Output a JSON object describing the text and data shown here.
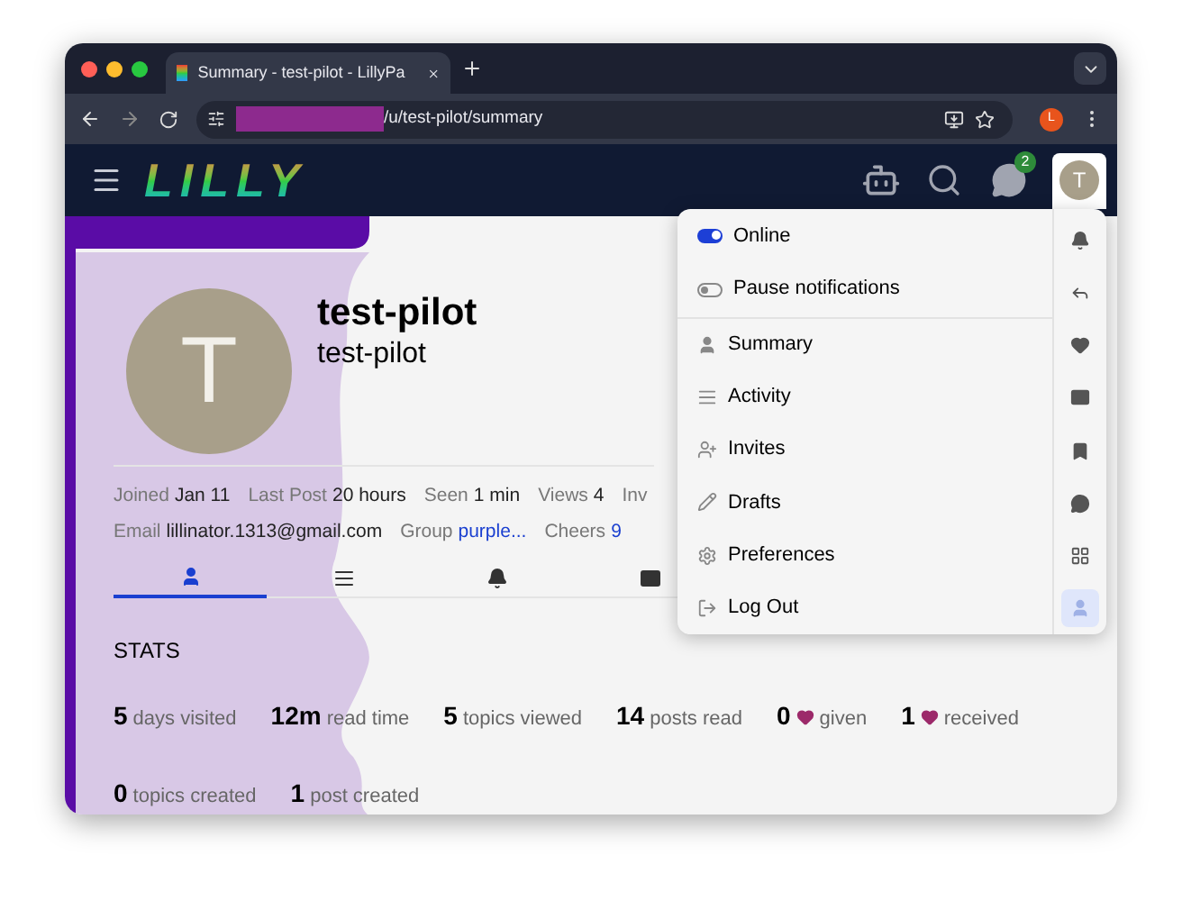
{
  "browser": {
    "tab_title": "Summary - test-pilot - LillyPa",
    "url_path": "/u/test-pilot/summary",
    "profile_initial": "L"
  },
  "header": {
    "logo": "LILLY",
    "chat_badge": "2",
    "avatar_initial": "T"
  },
  "profile": {
    "avatar_initial": "T",
    "name": "test-pilot",
    "username": "test-pilot",
    "meta_rows": [
      [
        {
          "label": "Joined",
          "value": "Jan 11",
          "link": false
        },
        {
          "label": "Last Post",
          "value": "20 hours",
          "link": false
        },
        {
          "label": "Seen",
          "value": "1 min",
          "link": false
        },
        {
          "label": "Views",
          "value": "4",
          "link": false
        },
        {
          "label": "Inv"
        }
      ],
      [
        {
          "label": "Email",
          "value": "lillinator.1313@gmail.com",
          "link": false
        },
        {
          "label": "Group",
          "value": "purple...",
          "link": true
        },
        {
          "label": "Cheers",
          "value": "9",
          "link": true
        }
      ]
    ],
    "nav_tabs": [
      {
        "kind": "summary",
        "selected": true
      },
      {
        "kind": "activity",
        "selected": false
      },
      {
        "kind": "notifications",
        "selected": false
      },
      {
        "kind": "messages",
        "selected": false
      }
    ]
  },
  "stats": {
    "title": "STATS",
    "rows": [
      [
        {
          "number": "5",
          "caption": "days visited",
          "heart": false
        },
        {
          "number": "12m",
          "caption": "read time",
          "heart": false
        },
        {
          "number": "5",
          "caption": "topics viewed",
          "heart": false
        },
        {
          "number": "14",
          "caption": "posts read",
          "heart": false
        },
        {
          "number": "0",
          "caption": "given",
          "heart": true
        },
        {
          "number": "1",
          "caption": "received",
          "heart": true
        }
      ],
      [
        {
          "number": "0",
          "caption": "topics created",
          "heart": false
        },
        {
          "number": "1",
          "caption": "post created",
          "heart": false
        }
      ]
    ]
  },
  "menu": {
    "toggles": [
      {
        "label": "Online",
        "on": true
      },
      {
        "label": "Pause notifications",
        "on": false
      }
    ],
    "items": [
      {
        "kind": "summary",
        "label": "Summary"
      },
      {
        "kind": "activity",
        "label": "Activity"
      },
      {
        "kind": "invites",
        "label": "Invites"
      },
      {
        "kind": "drafts",
        "label": "Drafts"
      },
      {
        "kind": "preferences",
        "label": "Preferences"
      },
      {
        "kind": "logout",
        "label": "Log Out"
      }
    ],
    "side_tabs": [
      {
        "kind": "notifications",
        "selected": false
      },
      {
        "kind": "replies",
        "selected": false
      },
      {
        "kind": "likes",
        "selected": false
      },
      {
        "kind": "messages",
        "selected": false
      },
      {
        "kind": "bookmarks",
        "selected": false
      },
      {
        "kind": "chat",
        "selected": false
      },
      {
        "kind": "widgets",
        "selected": false
      },
      {
        "kind": "profile",
        "selected": true
      }
    ]
  }
}
